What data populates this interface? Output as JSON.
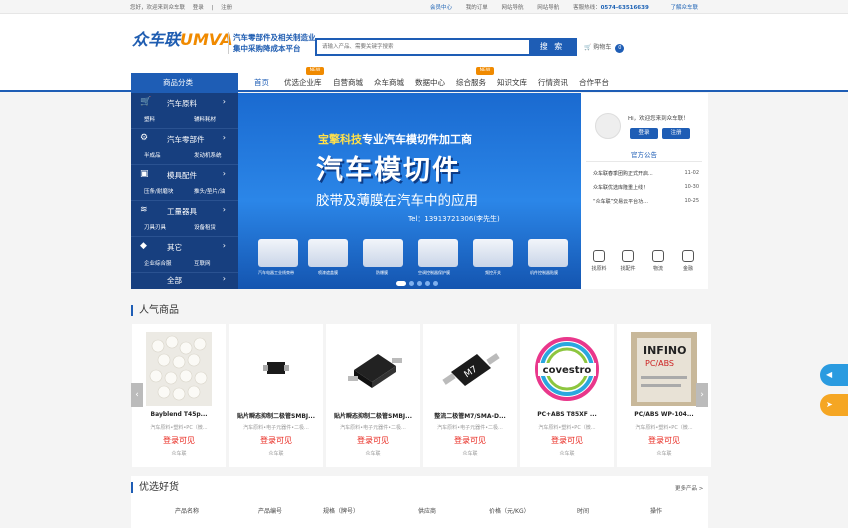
{
  "topbar": {
    "welcome": "您好，欢迎来到众车联",
    "login": "登录",
    "register": "注册",
    "links": [
      "会员中心",
      "我的订单",
      "网站导航",
      "网站导航",
      "客服热线：",
      "0574-63516639",
      "了解众车联"
    ]
  },
  "header": {
    "logo_main": "众车联",
    "logo_brand": "UMVA",
    "slogan_line1": "汽车零部件及相关制造业",
    "slogan_line2": "集中采购降成本平台",
    "search_placeholder": "请输入产品、需要关键字搜索",
    "search_button": "搜 索",
    "cart_label": "购物车",
    "cart_count": "0"
  },
  "nav": {
    "category_title": "商品分类",
    "items": [
      "首页",
      "优选企业库",
      "自营商城",
      "众车商城",
      "数据中心",
      "综合服务",
      "知识文库",
      "行情资讯",
      "合作平台"
    ],
    "new_badge": "NEW"
  },
  "categories": [
    {
      "name": "汽车原料",
      "sub1": "塑料",
      "sub2": "辅料耗材",
      "icon": "cart-icon"
    },
    {
      "name": "汽车零部件",
      "sub1": "半成品",
      "sub2": "发动机系统",
      "icon": "gear-icon"
    },
    {
      "name": "模具配件",
      "sub1": "压条/耐磨块",
      "sub2": "推头/垫片/油",
      "icon": "mold-icon"
    },
    {
      "name": "工量器具",
      "sub1": "刀具刃具",
      "sub2": "设备租赁",
      "icon": "layers-icon"
    },
    {
      "name": "其它",
      "sub1": "企业综合服",
      "sub2": "互联网",
      "icon": "diamond-icon"
    },
    {
      "name": "全部",
      "sub1": "",
      "sub2": "",
      "icon": ""
    }
  ],
  "banner": {
    "line1_brand": "宝擎科技",
    "line1_rest": "专业汽车模切件加工商",
    "line2": "汽车模切件",
    "line3": "胶带及薄膜在汽车中的应用",
    "tel": "Tel：13913721306(李先生)",
    "products": [
      "汽车电器工业线束带",
      "喷漆遮盖膜",
      "防爆膜",
      "空调控制器保护膜",
      "频控开关",
      "机件控制器贴膜"
    ]
  },
  "user_panel": {
    "greeting": "Hi，欢迎您来到众车联！",
    "login": "登录",
    "register": "注册",
    "notice_title": "官方公告",
    "notices": [
      {
        "text": "众车联春季团购正式开启...",
        "date": "11-02"
      },
      {
        "text": "众车联优选库隆重上线！",
        "date": "10-30"
      },
      {
        "text": "“众车联”交易云平台功...",
        "date": "10-25"
      }
    ],
    "quick": [
      "找原料",
      "找配件",
      "物流",
      "金融"
    ]
  },
  "hot": {
    "title": "人气商品",
    "products": [
      {
        "name": "Bayblend T45p...",
        "cat": "汽车原料•塑料•PC（微...",
        "price": "登录可见",
        "seller": "众车联"
      },
      {
        "name": "贴片瞬态抑制二极管SMBJ...",
        "cat": "汽车原料•电子元器件•二极...",
        "price": "登录可见",
        "seller": "众车联"
      },
      {
        "name": "贴片瞬态抑制二极管SMBJ...",
        "cat": "汽车原料•电子元器件•二极...",
        "price": "登录可见",
        "seller": "众车联"
      },
      {
        "name": "整流二极管M7/SMA-D...",
        "cat": "汽车原料•电子元器件•二极...",
        "price": "登录可见",
        "seller": "众车联"
      },
      {
        "name": "PC+ABS T85XF ...",
        "cat": "汽车原料•塑料•PC（微...",
        "price": "登录可见",
        "seller": "众车联"
      },
      {
        "name": "PC/ABS WP-104...",
        "cat": "汽车原料•塑料•PC（微...",
        "price": "登录可见",
        "seller": "众车联"
      }
    ]
  },
  "selected": {
    "title": "优选好货",
    "more": "更多产品 >",
    "columns": [
      "产品名称",
      "产品编号",
      "规格（牌号）",
      "供应商",
      "价格（元/KG）",
      "时间",
      "操作"
    ]
  },
  "colors": {
    "brand_blue": "#1e5db5",
    "orange": "#f08a00",
    "price_red": "#e8231a"
  }
}
